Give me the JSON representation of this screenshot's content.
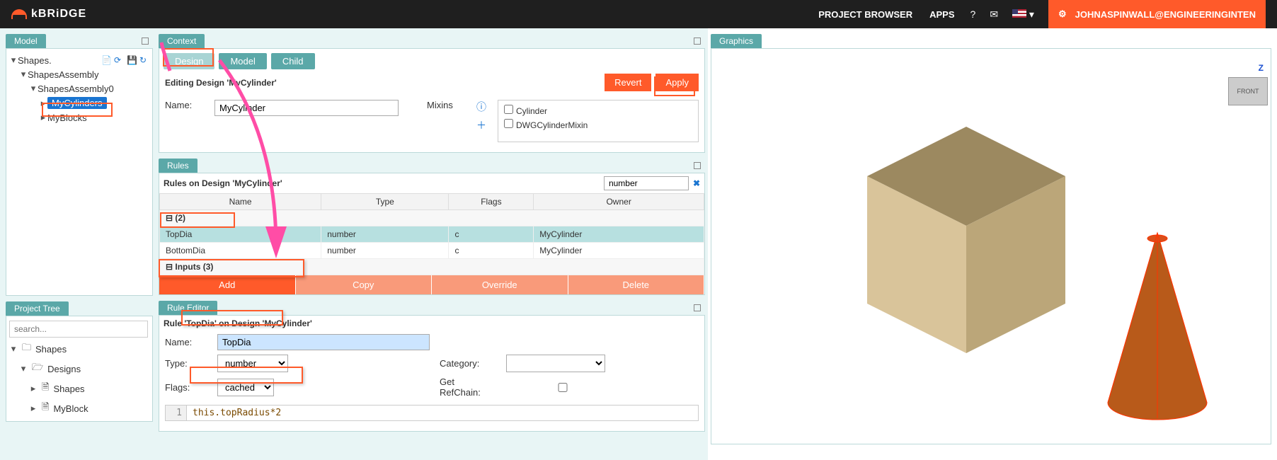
{
  "nav": {
    "brand": "kBRiDGE",
    "project_browser": "PROJECT BROWSER",
    "apps": "APPS",
    "help": "?",
    "user": "JOHNASPINWALL@ENGINEERINGINTEN"
  },
  "model": {
    "title": "Model",
    "root": "Shapes.",
    "items": {
      "assembly": "ShapesAssembly",
      "assembly0": "ShapesAssembly0",
      "cyl": "MyCylinders",
      "blocks": "MyBlocks"
    }
  },
  "project_tree": {
    "title": "Project Tree",
    "search_placeholder": "search...",
    "root": "Shapes",
    "designs": "Designs",
    "shapes": "Shapes",
    "myblock": "MyBlock"
  },
  "context": {
    "title": "Context",
    "tabs": {
      "design": "Design",
      "model": "Model",
      "child": "Child"
    },
    "editing": "Editing Design 'MyCylinder'",
    "revert": "Revert",
    "apply": "Apply",
    "name_label": "Name:",
    "name_value": "MyCylinder",
    "mixins_label": "Mixins",
    "mixin1": "Cylinder",
    "mixin2": "DWGCylinderMixin"
  },
  "rules": {
    "title": "Rules",
    "header": "Rules on Design 'MyCylinder'",
    "filter": "number",
    "cols": {
      "name": "Name",
      "type": "Type",
      "flags": "Flags",
      "owner": "Owner"
    },
    "group1": "(2)",
    "r1": {
      "name": "TopDia",
      "type": "number",
      "flags": "c",
      "owner": "MyCylinder"
    },
    "r2": {
      "name": "BottomDia",
      "type": "number",
      "flags": "c",
      "owner": "MyCylinder"
    },
    "group2": "Inputs (3)",
    "add": "Add",
    "copy": "Copy",
    "override": "Override",
    "delete": "Delete"
  },
  "editor": {
    "title": "Rule Editor",
    "header": "Rule 'TopDia' on Design 'MyCylinder'",
    "name_label": "Name:",
    "name_value": "TopDia",
    "type_label": "Type:",
    "type_value": "number",
    "cat_label": "Category:",
    "flags_label": "Flags:",
    "flags_value": "cached",
    "refchain_label": "Get RefChain:",
    "line_no": "1",
    "code": "this.topRadius*2"
  },
  "graphics": {
    "title": "Graphics",
    "axis_z": "Z",
    "cube_front": "FRONT"
  }
}
